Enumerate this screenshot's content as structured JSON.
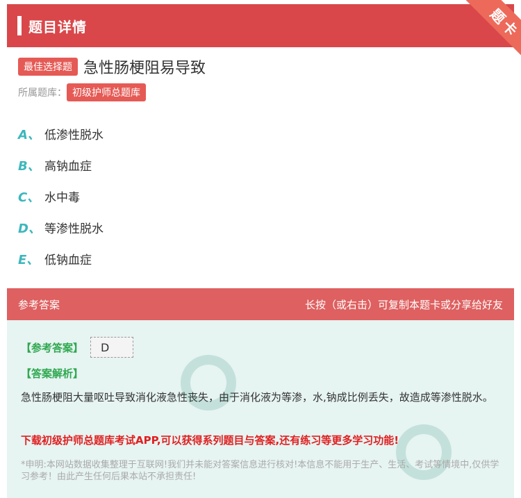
{
  "header": {
    "title": "题目详情",
    "ribbon": "题卡"
  },
  "question": {
    "type_tag": "最佳选择题",
    "text": "急性肠梗阻易导致",
    "bank_label": "所属题库：",
    "bank_name": "初级护师总题库"
  },
  "options": [
    {
      "letter": "A、",
      "text": "低渗性脱水"
    },
    {
      "letter": "B、",
      "text": "高钠血症"
    },
    {
      "letter": "C、",
      "text": "水中毒"
    },
    {
      "letter": "D、",
      "text": "等渗性脱水"
    },
    {
      "letter": "E、",
      "text": "低钠血症"
    }
  ],
  "answer": {
    "section_title": "参考答案",
    "copy_hint": "长按（或右击）可复制本题卡或分享给好友",
    "answer_label": "【参考答案】",
    "answer_value": "D",
    "analysis_label": "【答案解析】",
    "analysis_text": "急性肠梗阻大量呕吐导致消化液急性丧失，由于消化液为等渗，水,钠成比例丢失，故造成等渗性脱水。",
    "download_text": "下载初级护师总题库考试APP,可以获得系列题目与答案,还有练习等更多学习功能!",
    "disclaimer": "*申明:本网站数据收集整理于互联网!我们并未能对答案信息进行核对!本信息不能用于生产、生活、考试等情境中,仅供学习参考！由此产生任何后果本站不承担责任!"
  },
  "colors": {
    "header": "#d9474a",
    "accent_teal": "#3cb7bd",
    "tag": "#e55a55",
    "answer_bg": "#e6f4f2"
  }
}
